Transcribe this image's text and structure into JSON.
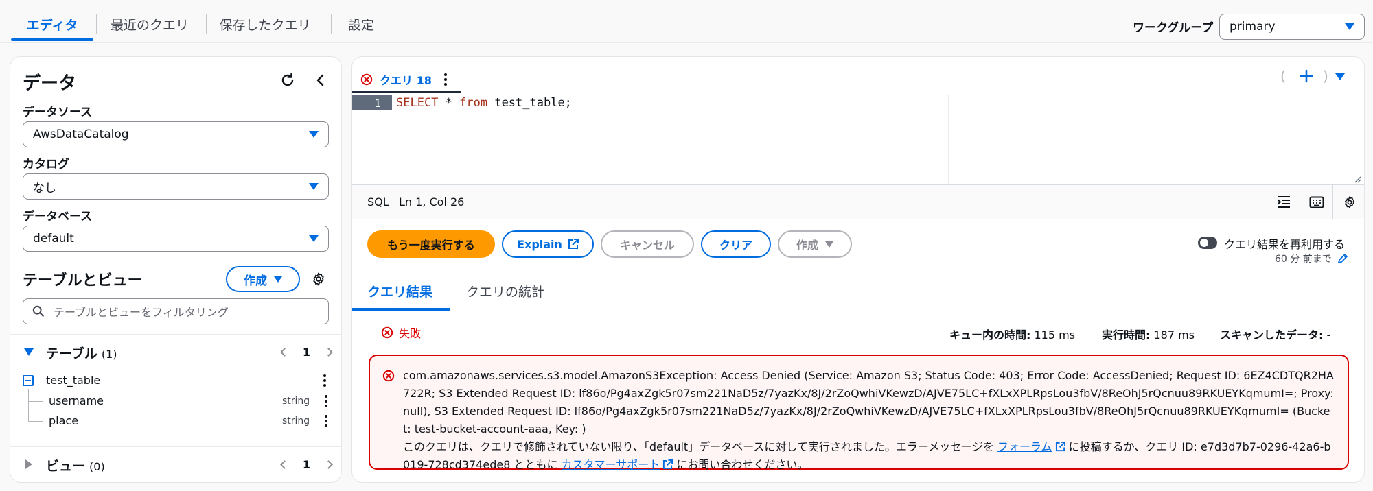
{
  "top_tabs": [
    {
      "label": "エディタ",
      "active": true
    },
    {
      "label": "最近のクエリ",
      "active": false
    },
    {
      "label": "保存したクエリ",
      "active": false
    },
    {
      "label": "設定",
      "active": false
    }
  ],
  "workgroup": {
    "label": "ワークグループ",
    "value": "primary"
  },
  "data_panel": {
    "title": "データ",
    "datasource": {
      "label": "データソース",
      "value": "AwsDataCatalog"
    },
    "catalog": {
      "label": "カタログ",
      "value": "なし"
    },
    "database": {
      "label": "データベース",
      "value": "default"
    },
    "tables_views_title": "テーブルとビュー",
    "create_label": "作成",
    "filter_placeholder": "テーブルとビューをフィルタリング",
    "tables_section": {
      "label": "テーブル",
      "count": "(1)",
      "page": "1"
    },
    "table": {
      "name": "test_table",
      "columns": [
        {
          "name": "username",
          "type": "string"
        },
        {
          "name": "place",
          "type": "string"
        }
      ]
    },
    "views_section": {
      "label": "ビュー",
      "count": "(0)",
      "page": "1"
    }
  },
  "query_tab": {
    "label": "クエリ 18",
    "status": "error"
  },
  "editor": {
    "line_number": "1",
    "code_keyword_select": "SELECT",
    "code_mid": " * ",
    "code_keyword_from": "from",
    "code_rest": " test_table;"
  },
  "status_bar": {
    "language": "SQL",
    "position": "Ln 1, Col 26"
  },
  "actions": {
    "rerun": "もう一度実行する",
    "explain": "Explain",
    "cancel": "キャンセル",
    "clear": "クリア",
    "create": "作成"
  },
  "reuse_results": {
    "label": "クエリ結果を再利用する",
    "sub": "60 分 前まで",
    "enabled": false
  },
  "result_tabs": [
    {
      "label": "クエリ結果",
      "active": true
    },
    {
      "label": "クエリの統計",
      "active": false
    }
  ],
  "result": {
    "status": "失敗",
    "queue_time_label": "キュー内の時間:",
    "queue_time": "115 ms",
    "run_time_label": "実行時間:",
    "run_time": "187 ms",
    "scanned_label": "スキャンしたデータ:",
    "scanned": "-"
  },
  "error": {
    "message": "com.amazonaws.services.s3.model.AmazonS3Exception: Access Denied (Service: Amazon S3; Status Code: 403; Error Code: AccessDenied; Request ID: 6EZ4CDTQR2HA722R; S3 Extended Request ID: lf86o/Pg4axZgk5r07sm221NaD5z/7yazKx/8J/2rZoQwhiVKewzD/AJVE75LC+fXLxXPLRpsLou3fbV/8ReOhJ5rQcnuu89RKUEYKqmumI=; Proxy: null), S3 Extended Request ID: lf86o/Pg4axZgk5r07sm221NaD5z/7yazKx/8J/2rZoQwhiVKewzD/AJVE75LC+fXLxXPLRpsLou3fbV/8ReOhJ5rQcnuu89RKUEYKqmumI= (Bucket: test-bucket-account-aaa, Key: )",
    "note_prefix": "このクエリは、クエリで修飾されていない限り、「default」データベースに対して実行されました。エラーメッセージを ",
    "forum_link": "フォーラム",
    "note_mid": " に投稿するか、クエリ ID: e7d3d7b7-0296-42a6-b019-728cd374ede8 とともに ",
    "support_link": "カスタマーサポート",
    "note_suffix": " にお問い合わせください。"
  },
  "colors": {
    "accent": "#006ce0",
    "primary_button": "#ff9900",
    "error": "#db0000"
  }
}
